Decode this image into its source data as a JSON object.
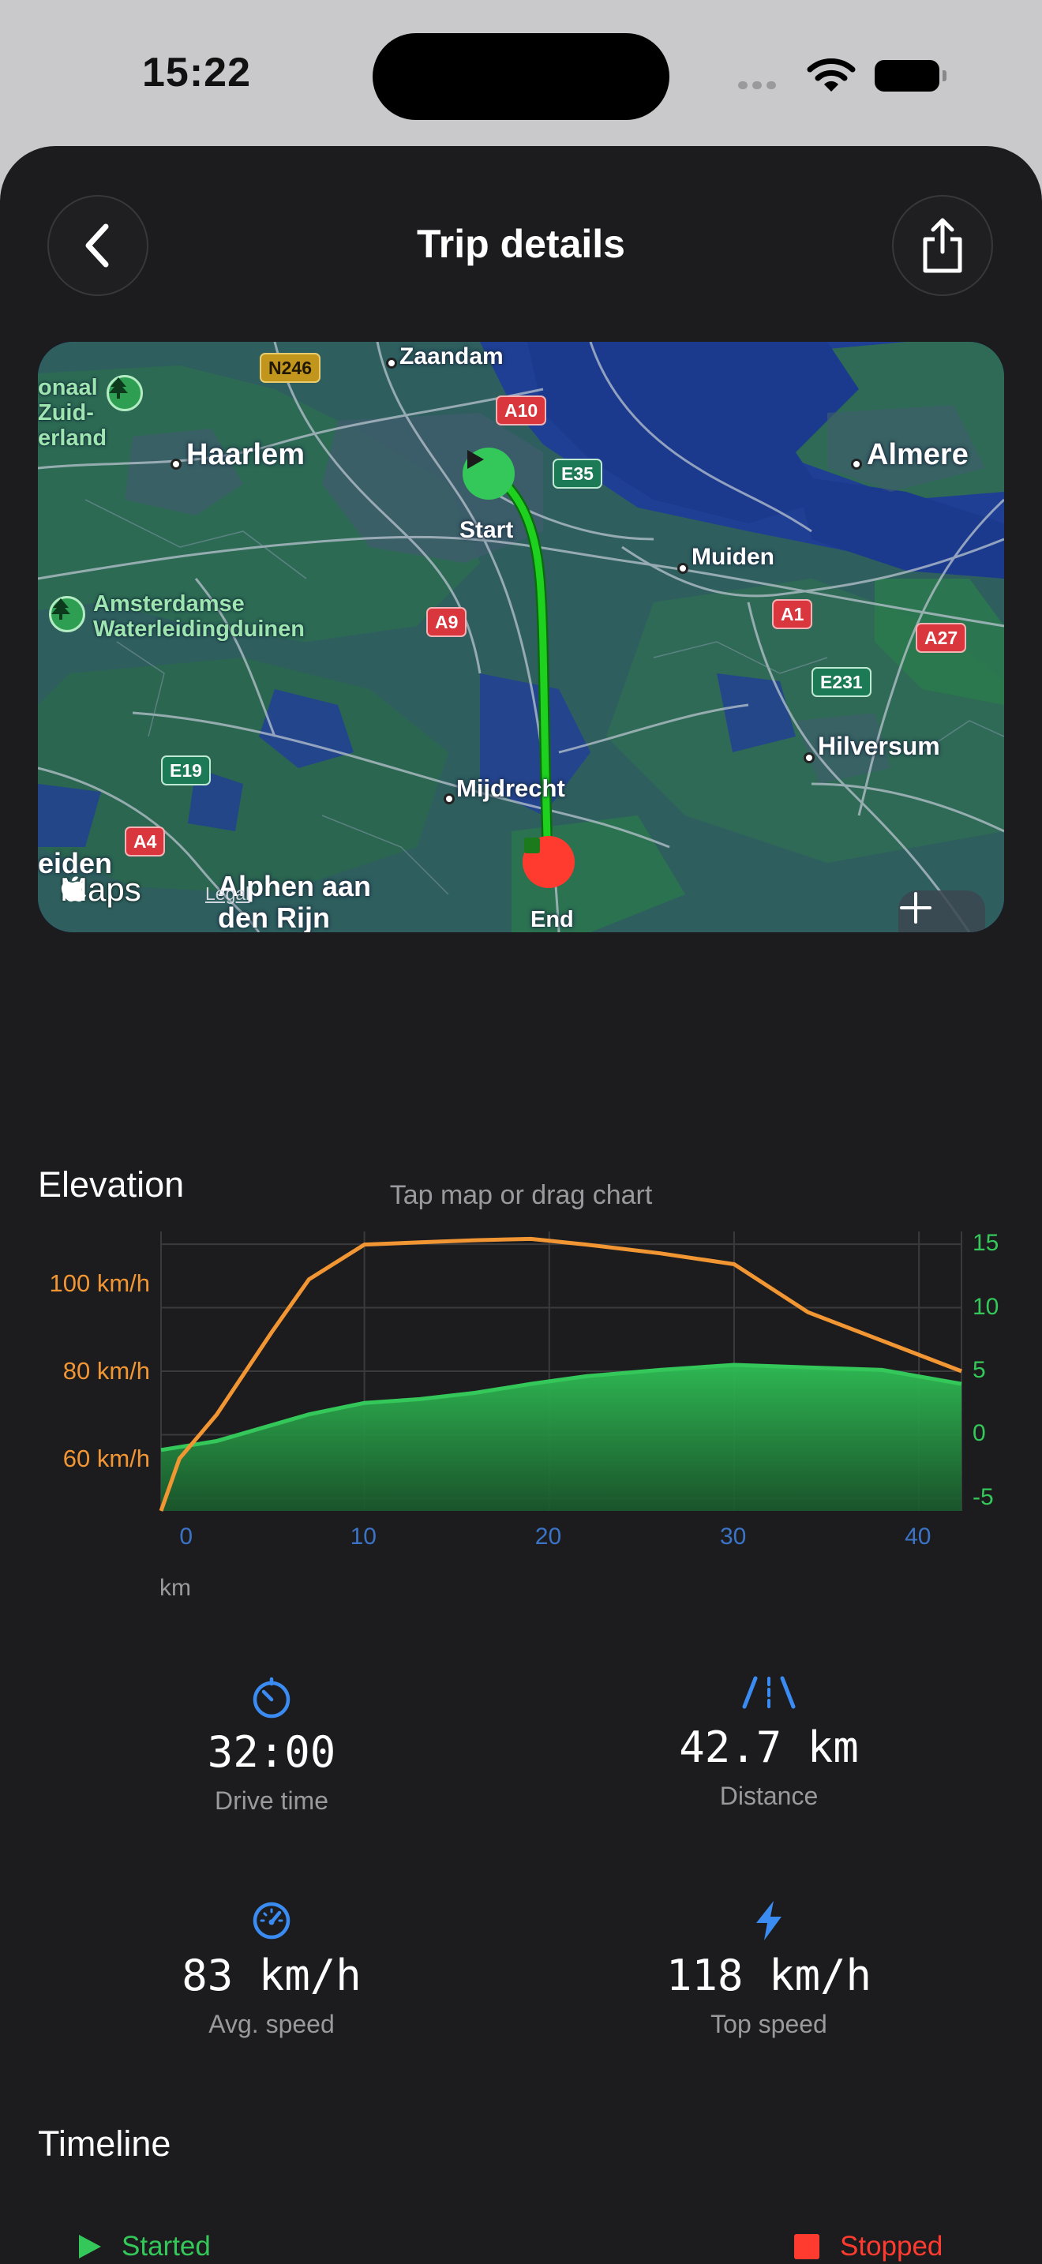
{
  "status_bar": {
    "time": "15:22"
  },
  "header": {
    "title": "Trip details"
  },
  "map": {
    "places": [
      "Zaandam",
      "Haarlem",
      "Almere",
      "Muiden",
      "Hilversum",
      "Mijdrecht",
      "Alphen aan den Rijn",
      "Leiden"
    ],
    "park_labels": [
      "Nationaal Park Zuid-Kennemerland",
      "Amsterdamse Waterleidingduinen"
    ],
    "park_fragment_lines": [
      "onaal",
      "Zuid-",
      "erland"
    ],
    "park_2_lines": [
      "Amsterdamse",
      "Waterleidingduinen"
    ],
    "alphen_lines": [
      "Alphen aan",
      "den Rijn"
    ],
    "leiden_fragment": "eiden",
    "hilversum_fragment": "Hilversum",
    "road_shields": {
      "n246": "N246",
      "a10": "A10",
      "e35": "E35",
      "a9": "A9",
      "a1": "A1",
      "a27": "A27",
      "e231": "E231",
      "e19": "E19",
      "a4": "A4"
    },
    "start_label": "Start",
    "end_label": "End",
    "maps_brand": "Maps",
    "legal": "Legal",
    "route_color": "#1fd11f",
    "start_color": "#34c759",
    "end_color": "#ff3b30"
  },
  "hint": "Tap map or drag chart",
  "elevation": {
    "title": "Elevation",
    "x_unit": "km"
  },
  "chart_data": {
    "type": "line",
    "x_ticks": [
      "0",
      "10",
      "20",
      "30",
      "40"
    ],
    "xlim": [
      -1,
      42.3
    ],
    "y_left_ticks": [
      "100 km/h",
      "80 km/h",
      "60 km/h"
    ],
    "y_left_tick_values": [
      100,
      80,
      60
    ],
    "y_left_lim": [
      48,
      112
    ],
    "y_right_ticks": [
      "15",
      "10",
      "5",
      "0",
      "-5"
    ],
    "y_right_tick_values": [
      15,
      10,
      5,
      0,
      -5
    ],
    "y_right_lim": [
      -6,
      16
    ],
    "series": [
      {
        "axis": "left",
        "kind": "line",
        "color": "#f29634",
        "x": [
          -1,
          0,
          2,
          5,
          7,
          10,
          13,
          16,
          19,
          22,
          26,
          30,
          34,
          38,
          42.3
        ],
        "values": [
          48,
          60,
          70,
          89,
          101,
          109,
          109.5,
          110,
          110.3,
          109,
          107,
          104.5,
          93.5,
          87,
          80
        ]
      },
      {
        "axis": "right",
        "kind": "area",
        "color": "#34c759",
        "x": [
          -1,
          2,
          7,
          10,
          13,
          16,
          19,
          22,
          26,
          30,
          34,
          38,
          42.3
        ],
        "values": [
          -1.2,
          -0.5,
          1.6,
          2.5,
          2.8,
          3.3,
          4.0,
          4.6,
          5.1,
          5.5,
          5.3,
          5.1,
          4.0
        ]
      }
    ]
  },
  "stats": [
    {
      "icon": "timer-icon",
      "value": "32:00",
      "label": "Drive time"
    },
    {
      "icon": "road-icon",
      "value": "42.7 km",
      "label": "Distance"
    },
    {
      "icon": "speedometer-icon",
      "value": "83 km/h",
      "label": "Avg. speed"
    },
    {
      "icon": "bolt-icon",
      "value": "118 km/h",
      "label": "Top speed"
    }
  ],
  "timeline": {
    "title": "Timeline",
    "started_label": "Started",
    "stopped_label": "Stopped"
  },
  "colors": {
    "accent_blue": "#3b8cf2",
    "orange": "#f29634",
    "green": "#34c759",
    "red": "#ff3b30",
    "background": "#1c1c1e"
  }
}
